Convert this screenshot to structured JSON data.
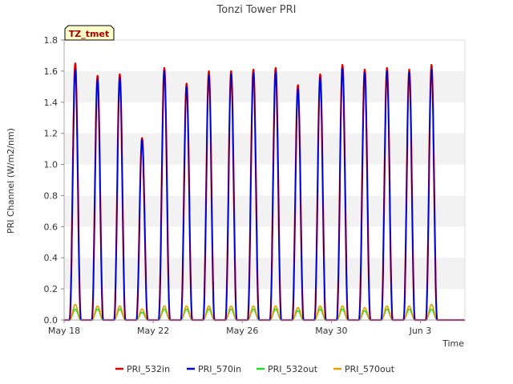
{
  "chart_data": {
    "type": "line",
    "title": "Tonzi Tower PRI",
    "xlabel": "Time",
    "ylabel": "PRI Channel (W/m2/nm)",
    "badge": "TZ_tmet",
    "ylim": [
      0.0,
      1.8
    ],
    "yticks": [
      "0.0",
      "0.2",
      "0.4",
      "0.6",
      "0.8",
      "1.0",
      "1.2",
      "1.4",
      "1.6",
      "1.8"
    ],
    "xlim": [
      "2024-05-18",
      "2024-06-05"
    ],
    "xticks": [
      {
        "date": "2024-05-18",
        "label": "May 18"
      },
      {
        "date": "2024-05-22",
        "label": "May 22"
      },
      {
        "date": "2024-05-26",
        "label": "May 26"
      },
      {
        "date": "2024-05-30",
        "label": "May 30"
      },
      {
        "date": "2024-06-03",
        "label": "Jun 3"
      }
    ],
    "grid": "horizontal bands",
    "legend_position": "bottom",
    "days": [
      "2024-05-18",
      "2024-05-19",
      "2024-05-20",
      "2024-05-21",
      "2024-05-22",
      "2024-05-23",
      "2024-05-24",
      "2024-05-25",
      "2024-05-26",
      "2024-05-27",
      "2024-05-28",
      "2024-05-29",
      "2024-05-30",
      "2024-05-31",
      "2024-06-01",
      "2024-06-02",
      "2024-06-03",
      "2024-06-04"
    ],
    "series": [
      {
        "name": "PRI_532in",
        "color": "#dd0000",
        "daily_peak": [
          1.65,
          1.57,
          1.58,
          1.17,
          1.62,
          1.52,
          1.6,
          1.6,
          1.61,
          1.62,
          1.51,
          1.58,
          1.64,
          1.61,
          1.62,
          1.61,
          1.64,
          0
        ]
      },
      {
        "name": "PRI_570in",
        "color": "#0000cc",
        "daily_peak": [
          1.61,
          1.55,
          1.56,
          1.16,
          1.6,
          1.5,
          1.57,
          1.58,
          1.59,
          1.6,
          1.49,
          1.56,
          1.62,
          1.59,
          1.6,
          1.59,
          1.61,
          0
        ]
      },
      {
        "name": "PRI_532out",
        "color": "#22dd22",
        "daily_peak": [
          0.07,
          0.07,
          0.07,
          0.05,
          0.07,
          0.07,
          0.07,
          0.07,
          0.07,
          0.07,
          0.06,
          0.07,
          0.07,
          0.06,
          0.07,
          0.07,
          0.07,
          0
        ]
      },
      {
        "name": "PRI_570out",
        "color": "#e0a000",
        "daily_peak": [
          0.1,
          0.09,
          0.09,
          0.07,
          0.09,
          0.09,
          0.09,
          0.09,
          0.09,
          0.09,
          0.08,
          0.09,
          0.09,
          0.08,
          0.09,
          0.09,
          0.1,
          0
        ]
      }
    ]
  }
}
